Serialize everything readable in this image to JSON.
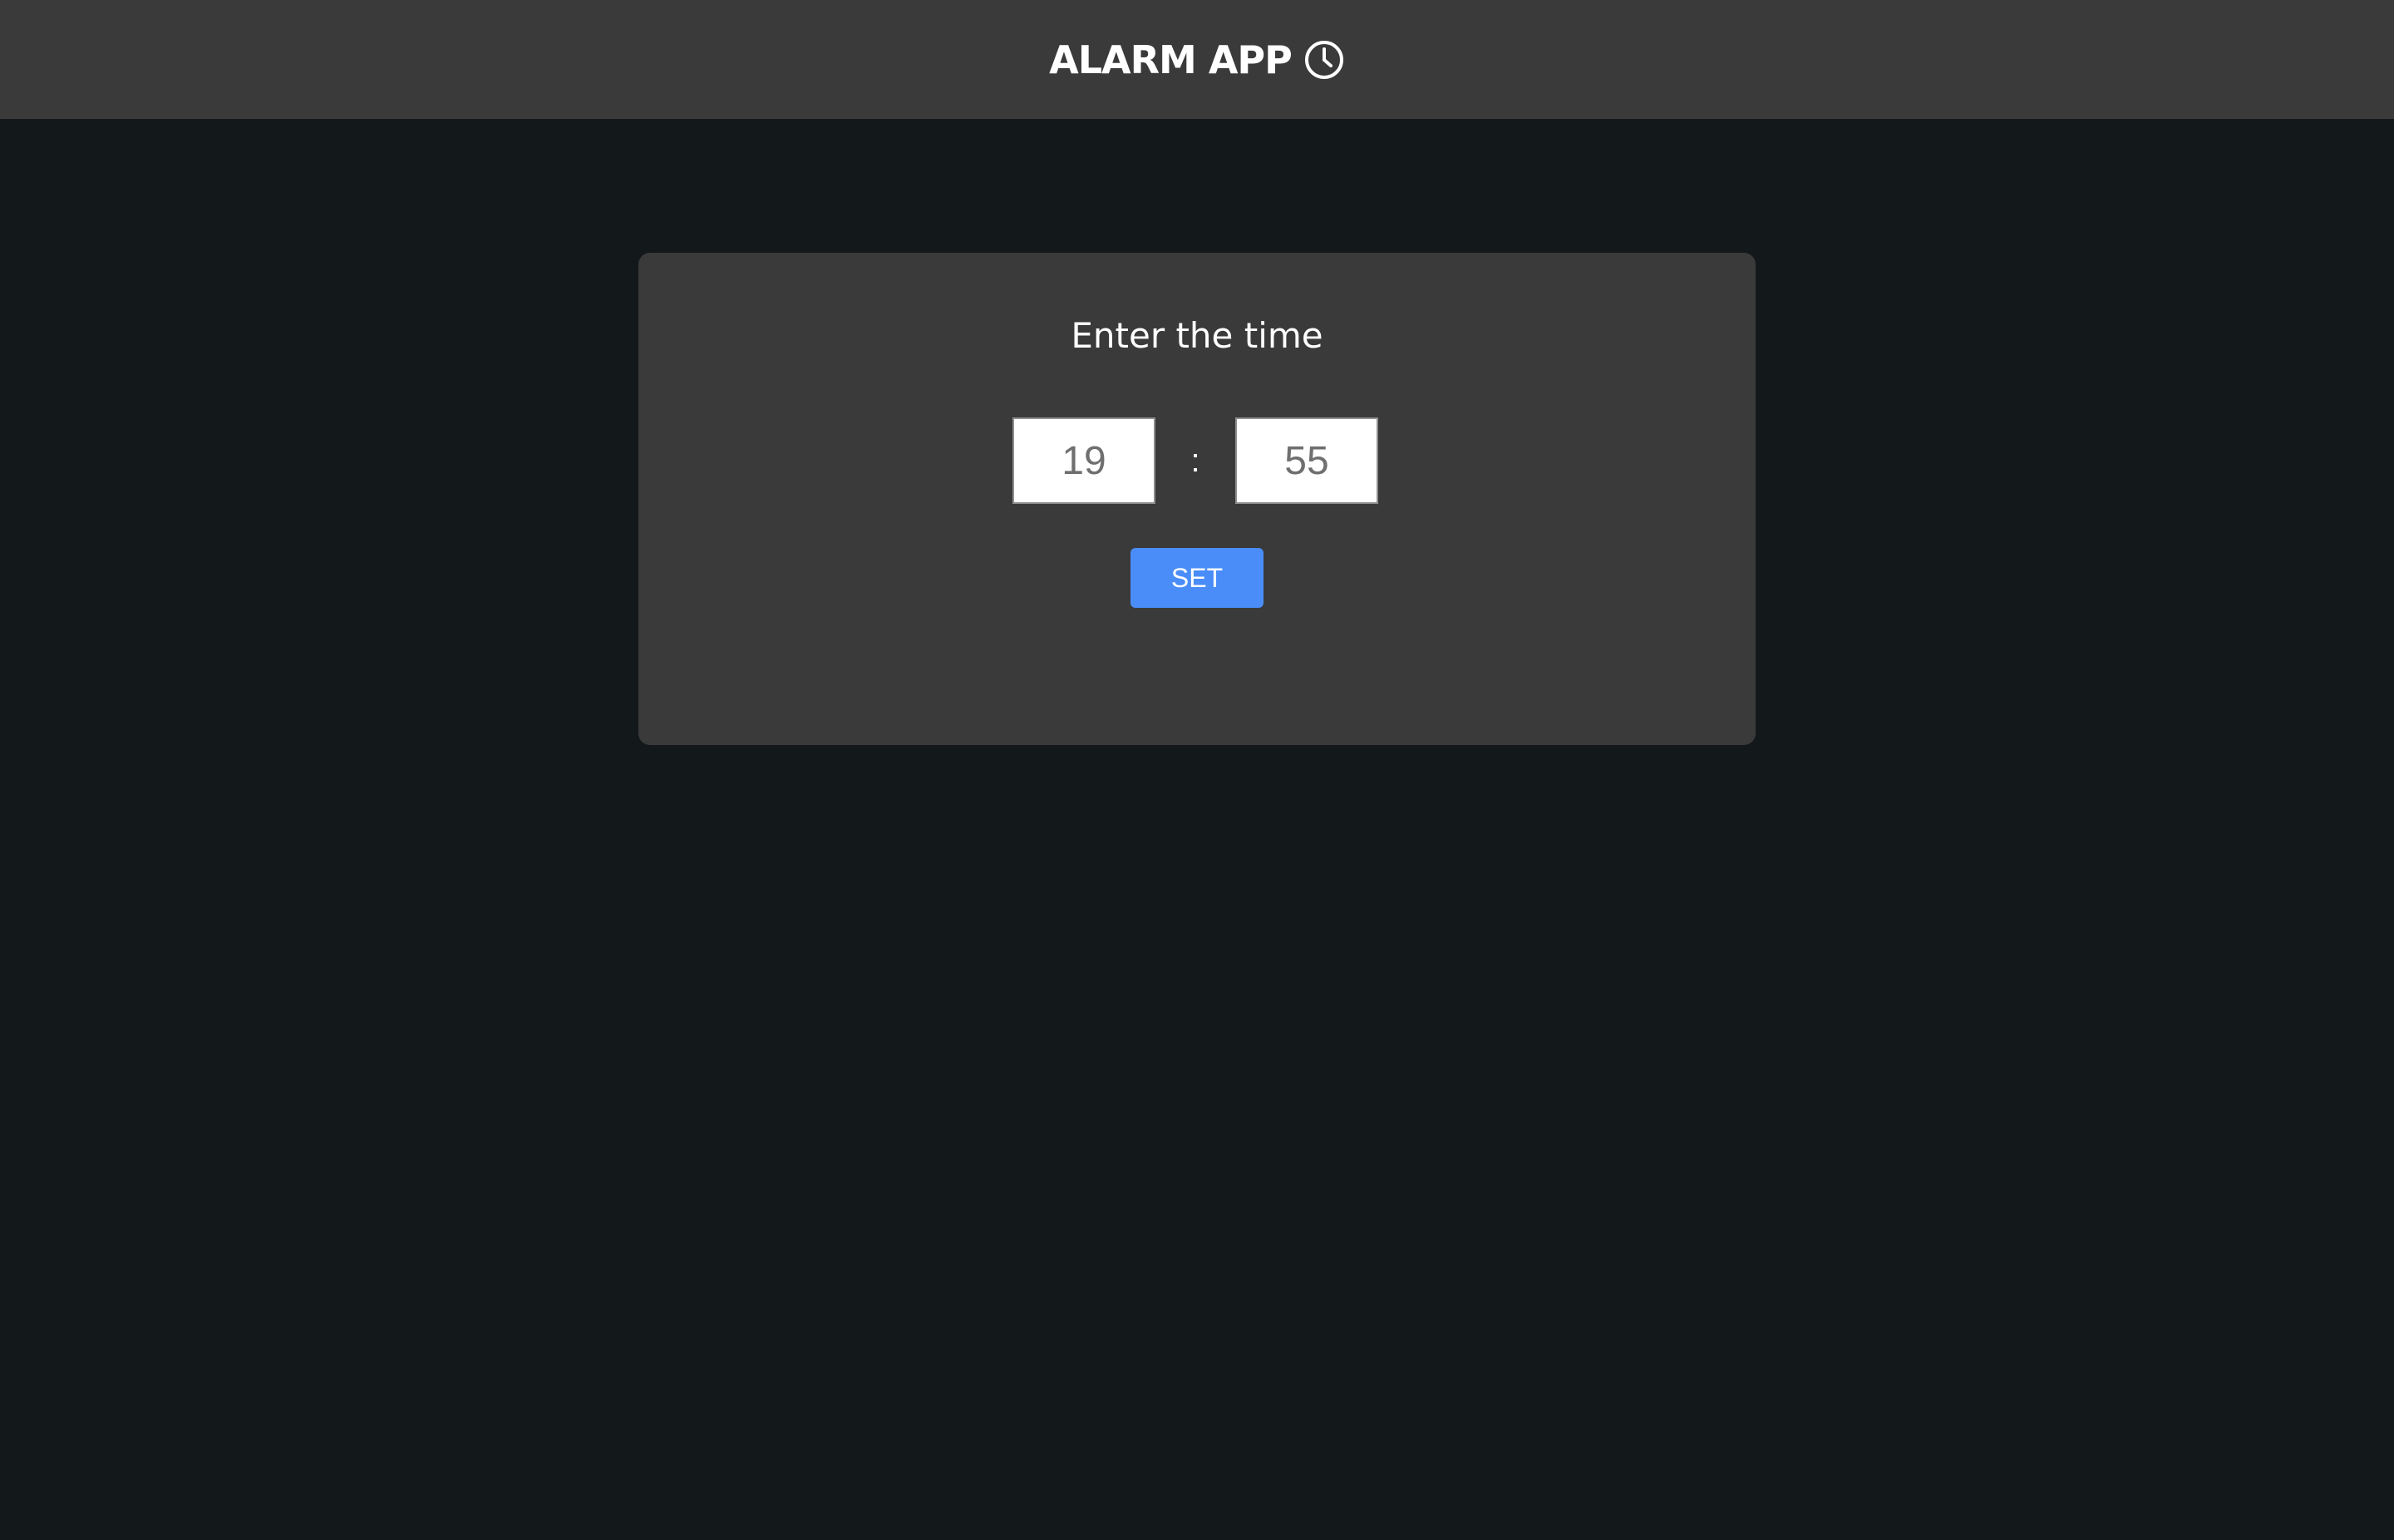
{
  "header": {
    "title": "ALARM APP",
    "icon": "clock-icon"
  },
  "alarm_form": {
    "prompt": "Enter the time",
    "hours_value": "19",
    "minutes_value": "55",
    "separator": ":",
    "set_label": "SET"
  },
  "colors": {
    "page_background": "#13181b",
    "panel_background": "#3a3a3a",
    "button_accent": "#4a8df8",
    "text": "#ffffff"
  }
}
